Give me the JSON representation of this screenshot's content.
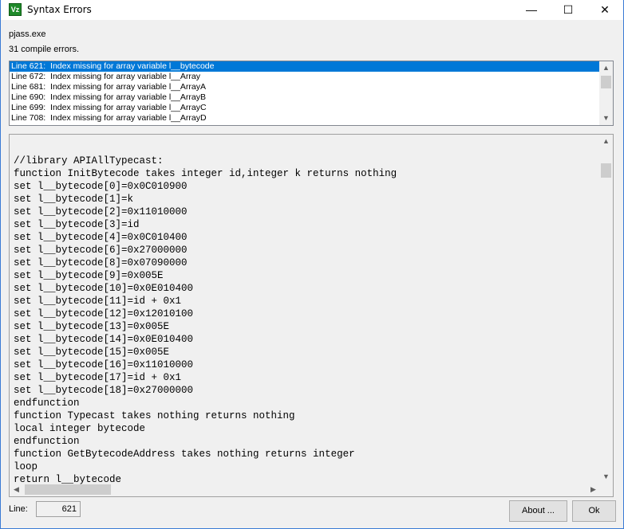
{
  "window": {
    "title": "Syntax Errors",
    "minimize": "—",
    "maximize": "☐",
    "close": "✕"
  },
  "tool": "pjass.exe",
  "summary": "31 compile errors.",
  "errors": [
    "Line 621:  Index missing for array variable l__bytecode",
    "Line 672:  Index missing for array variable l__Array",
    "Line 681:  Index missing for array variable l__ArrayA",
    "Line 690:  Index missing for array variable l__ArrayB",
    "Line 699:  Index missing for array variable l__ArrayC",
    "Line 708:  Index missing for array variable l__ArrayD"
  ],
  "code": [
    "",
    "//library APIAllTypecast:",
    "function InitBytecode takes integer id,integer k returns nothing",
    "set l__bytecode[0]=0x0C010900",
    "set l__bytecode[1]=k",
    "set l__bytecode[2]=0x11010000",
    "set l__bytecode[3]=id",
    "set l__bytecode[4]=0x0C010400",
    "set l__bytecode[6]=0x27000000",
    "set l__bytecode[8]=0x07090000",
    "set l__bytecode[9]=0x005E",
    "set l__bytecode[10]=0x0E010400",
    "set l__bytecode[11]=id + 0x1",
    "set l__bytecode[12]=0x12010100",
    "set l__bytecode[13]=0x005E",
    "set l__bytecode[14]=0x0E010400",
    "set l__bytecode[15]=0x005E",
    "set l__bytecode[16]=0x11010000",
    "set l__bytecode[17]=id + 0x1",
    "set l__bytecode[18]=0x27000000",
    "endfunction",
    "function Typecast takes nothing returns nothing",
    "local integer bytecode",
    "endfunction",
    "function GetBytecodeAddress takes nothing returns integer",
    "loop",
    "return l__bytecode"
  ],
  "footer": {
    "line_label": "Line:",
    "line_value": "621",
    "about": "About ...",
    "ok": "Ok"
  }
}
